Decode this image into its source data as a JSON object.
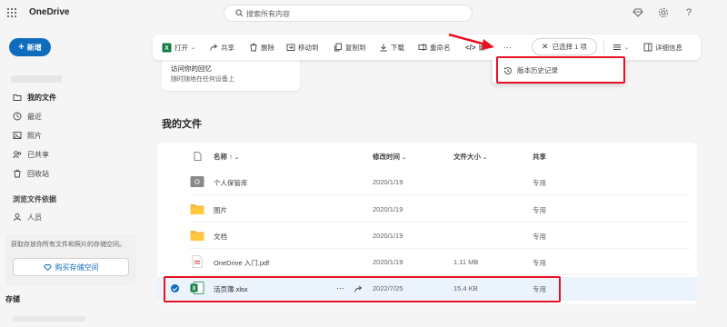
{
  "topbar": {
    "app_title": "OneDrive",
    "search_placeholder": "搜索所有内容",
    "icons": [
      "waffle-icon",
      "diamond-icon",
      "gear-icon",
      "help-icon"
    ]
  },
  "sidebar": {
    "new_label": "新增",
    "nav": [
      {
        "label": "我的文件",
        "icon": "folder-icon",
        "active": true
      },
      {
        "label": "最近",
        "icon": "clock-icon",
        "active": false
      },
      {
        "label": "照片",
        "icon": "image-icon",
        "active": false
      },
      {
        "label": "已共享",
        "icon": "share-icon",
        "active": false
      },
      {
        "label": "回收站",
        "icon": "recycle-icon",
        "active": false
      }
    ],
    "browse_label": "浏览文件依据",
    "people_label": "人员",
    "storage_text": "获取存放你所有文件和照片的存储空间。",
    "buy_label": "购买存储空间",
    "storage_label": "存储"
  },
  "toolbar": {
    "open": "打开",
    "share": "共享",
    "delete": "删除",
    "move_to": "移动到",
    "copy_to": "复制到",
    "download": "下载",
    "rename": "重命名",
    "embed": "嵌",
    "more": "···",
    "selected": "已选择 1 项",
    "details": "详细信息"
  },
  "dropdown": {
    "version_history": "版本历史记录"
  },
  "promo": {
    "title": "访问你的回忆",
    "subtitle": "随时随地在任何设备上"
  },
  "files": {
    "section_title": "我的文件",
    "columns": {
      "name": "名称 ↑",
      "modified": "修改时间",
      "size": "文件大小",
      "sharing": "共享"
    },
    "rows": [
      {
        "name": "个人保管库",
        "icon": "vault-icon",
        "modified": "2020/1/19",
        "size": "",
        "sharing": "专用",
        "selected": false
      },
      {
        "name": "图片",
        "icon": "folder-icon",
        "modified": "2020/1/19",
        "size": "",
        "sharing": "专用",
        "selected": false
      },
      {
        "name": "文档",
        "icon": "folder-icon",
        "modified": "2020/1/19",
        "size": "",
        "sharing": "专用",
        "selected": false
      },
      {
        "name": "OneDrive 入门.pdf",
        "icon": "pdf-icon",
        "modified": "2020/1/19",
        "size": "1.11 MB",
        "sharing": "专用",
        "selected": false
      },
      {
        "name": "活页簿.xlsx",
        "icon": "excel-icon",
        "modified": "2022/7/25",
        "size": "15.4 KB",
        "sharing": "专用",
        "selected": true
      }
    ]
  },
  "colors": {
    "accent": "#0f6cbd",
    "highlight": "#e81123",
    "excel_green": "#107c41",
    "folder_yellow": "#f4b942"
  }
}
